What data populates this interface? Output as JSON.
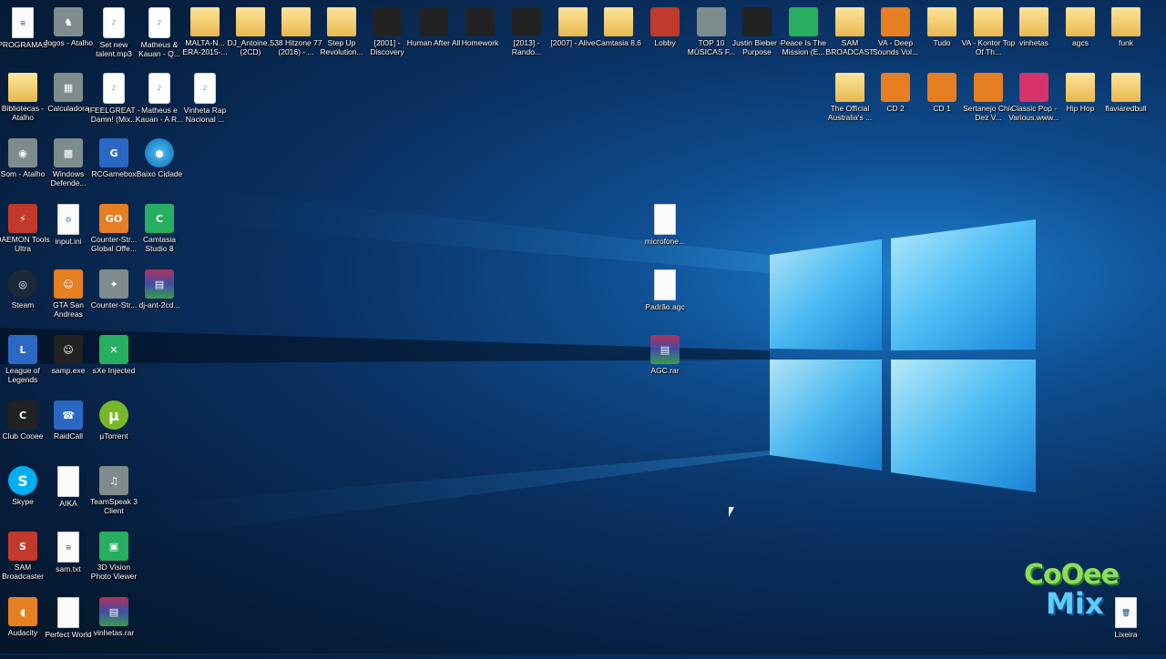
{
  "desktop": {
    "icons": [
      {
        "label": "PROGRAMAS",
        "glyph": "≡",
        "kind": "file",
        "icon": "document-icon"
      },
      {
        "label": "Jogos - Atalho",
        "glyph": "♞",
        "kind": "gray",
        "icon": "chess-icon"
      },
      {
        "label": "Set new talent.mp3",
        "glyph": "♪",
        "kind": "mp3",
        "icon": "mp3-icon"
      },
      {
        "label": "Matheus & Kauan - Q...",
        "glyph": "♪",
        "kind": "mp3",
        "icon": "mp3-icon"
      },
      {
        "label": "MALTA-N... ERA-2015-...",
        "glyph": "",
        "kind": "folder",
        "icon": "folder-icon"
      },
      {
        "label": "DJ_Antoine... (2CD)",
        "glyph": "",
        "kind": "folder",
        "icon": "folder-icon"
      },
      {
        "label": "538 Hitzone 77 (2016) - ...",
        "glyph": "",
        "kind": "folder",
        "icon": "folder-icon"
      },
      {
        "label": "Step Up Revolution...",
        "glyph": "",
        "kind": "folder",
        "icon": "folder-icon"
      },
      {
        "label": "[2001] - Discovery",
        "glyph": "",
        "kind": "dark",
        "icon": "album-folder-icon"
      },
      {
        "label": "Human After All",
        "glyph": "",
        "kind": "dark",
        "icon": "album-folder-icon"
      },
      {
        "label": "Homework",
        "glyph": "",
        "kind": "dark",
        "icon": "album-folder-icon"
      },
      {
        "label": "[2013] - Rando...",
        "glyph": "",
        "kind": "dark",
        "icon": "album-folder-icon"
      },
      {
        "label": "[2007] - Alive",
        "glyph": "",
        "kind": "folder",
        "icon": "folder-icon"
      },
      {
        "label": "Camtasia 8.6",
        "glyph": "",
        "kind": "folder",
        "icon": "folder-icon"
      },
      {
        "label": "Lobby",
        "glyph": "",
        "kind": "red",
        "icon": "album-folder-icon"
      },
      {
        "label": "TOP 10 MÚSICAS F...",
        "glyph": "",
        "kind": "gray",
        "icon": "album-folder-icon"
      },
      {
        "label": "Justin Bieber - Purpose",
        "glyph": "",
        "kind": "dark",
        "icon": "album-folder-icon"
      },
      {
        "label": "Peace Is The Mission (E...",
        "glyph": "",
        "kind": "green",
        "icon": "album-folder-icon"
      },
      {
        "label": "SAM BROADCAST",
        "glyph": "",
        "kind": "folder",
        "icon": "folder-icon"
      },
      {
        "label": "VA - Deep Sounds Vol...",
        "glyph": "",
        "kind": "orange",
        "icon": "album-folder-icon"
      },
      {
        "label": "Tudo",
        "glyph": "",
        "kind": "folder",
        "icon": "folder-icon"
      },
      {
        "label": "VA - Kontor Top Of Th...",
        "glyph": "",
        "kind": "folder",
        "icon": "folder-icon"
      },
      {
        "label": "vinhetas",
        "glyph": "",
        "kind": "folder",
        "icon": "folder-icon"
      },
      {
        "label": "agcs",
        "glyph": "",
        "kind": "folder",
        "icon": "folder-icon"
      },
      {
        "label": "funk",
        "glyph": "",
        "kind": "folder",
        "icon": "folder-icon"
      },
      {
        "label": "Bibliotecas - Atalho",
        "glyph": "",
        "kind": "folder",
        "icon": "libraries-icon"
      },
      {
        "label": "Calculadora",
        "glyph": "▦",
        "kind": "gray",
        "icon": "calculator-icon"
      },
      {
        "label": "IFEELGREAT - Damn! (Mix...",
        "glyph": "♪",
        "kind": "mp3",
        "icon": "mp3-icon"
      },
      {
        "label": "Matheus e Kauan - A R...",
        "glyph": "♪",
        "kind": "mp3",
        "icon": "mp3-icon"
      },
      {
        "label": "Vinheta Rap Nacional ...",
        "glyph": "♪",
        "kind": "mp3",
        "icon": "mp3-icon"
      },
      {
        "label": "The Official Australia's ...",
        "glyph": "",
        "kind": "folder",
        "icon": "folder-icon"
      },
      {
        "label": "CD 2",
        "glyph": "",
        "kind": "orange",
        "icon": "album-folder-icon"
      },
      {
        "label": "CD 1",
        "glyph": "",
        "kind": "orange",
        "icon": "album-folder-icon"
      },
      {
        "label": "Sertanejo Chic Dez V...",
        "glyph": "",
        "kind": "orange",
        "icon": "album-folder-icon"
      },
      {
        "label": "Classic Pop - Various.www...",
        "glyph": "",
        "kind": "pink",
        "icon": "album-folder-icon"
      },
      {
        "label": "Hip Hop",
        "glyph": "",
        "kind": "folder",
        "icon": "folder-icon"
      },
      {
        "label": "flaviaredbull",
        "glyph": "",
        "kind": "folder",
        "icon": "folder-icon"
      },
      {
        "label": "Som - Atalho",
        "glyph": "◉",
        "kind": "gray",
        "icon": "speaker-icon"
      },
      {
        "label": "Windows Defende...",
        "glyph": "▩",
        "kind": "gray",
        "icon": "windows-defender-icon"
      },
      {
        "label": "RCGamebox",
        "glyph": "G",
        "kind": "blue",
        "icon": "rcgamebox-icon"
      },
      {
        "label": "Baixo Cidade",
        "glyph": "●",
        "kind": "globe",
        "icon": "globe-icon"
      },
      {
        "label": "DAEMON Tools Ultra",
        "glyph": "⚡",
        "kind": "red",
        "icon": "daemon-tools-icon"
      },
      {
        "label": "input.ini",
        "glyph": "⚙",
        "kind": "file",
        "icon": "settings-file-icon"
      },
      {
        "label": "Counter-Str... Global Offe...",
        "glyph": "GO",
        "kind": "orange",
        "icon": "csgo-icon"
      },
      {
        "label": "Camtasia Studio 8",
        "glyph": "C",
        "kind": "green",
        "icon": "camtasia-icon"
      },
      {
        "label": "Steam",
        "glyph": "◎",
        "kind": "steam",
        "icon": "steam-icon"
      },
      {
        "label": "GTA San Andreas",
        "glyph": "☺",
        "kind": "orange",
        "icon": "gta-icon"
      },
      {
        "label": "Counter-Str...",
        "glyph": "✦",
        "kind": "gray",
        "icon": "counter-strike-icon"
      },
      {
        "label": "dj-ant-2cd...",
        "glyph": "▤",
        "kind": "rar",
        "icon": "winrar-icon"
      },
      {
        "label": "League of Legends",
        "glyph": "L",
        "kind": "blue",
        "icon": "league-of-legends-icon"
      },
      {
        "label": "samp.exe",
        "glyph": "☺",
        "kind": "dark",
        "icon": "samp-icon"
      },
      {
        "label": "sXe Injected",
        "glyph": "✕",
        "kind": "green",
        "icon": "sxe-icon"
      },
      {
        "label": "Club Cooee",
        "glyph": "C",
        "kind": "dark",
        "icon": "club-cooee-icon"
      },
      {
        "label": "RaidCall",
        "glyph": "☎",
        "kind": "blue",
        "icon": "raidcall-icon"
      },
      {
        "label": "µTorrent",
        "glyph": "µ",
        "kind": "torrent",
        "icon": "utorrent-icon"
      },
      {
        "label": "Skype",
        "glyph": "S",
        "kind": "skype",
        "icon": "skype-icon"
      },
      {
        "label": "AIKA",
        "glyph": "",
        "kind": "file",
        "icon": "document-icon"
      },
      {
        "label": "TeamSpeak 3 Client",
        "glyph": "♫",
        "kind": "gray",
        "icon": "teamspeak-icon"
      },
      {
        "label": "SAM Broadcaster",
        "glyph": "S",
        "kind": "red",
        "icon": "sam-broadcaster-icon"
      },
      {
        "label": "sam.txt",
        "glyph": "≡",
        "kind": "file",
        "icon": "text-file-icon"
      },
      {
        "label": "3D Vision Photo Viewer",
        "glyph": "▣",
        "kind": "green",
        "icon": "3d-vision-icon"
      },
      {
        "label": "Audacity",
        "glyph": "◖",
        "kind": "orange",
        "icon": "audacity-icon"
      },
      {
        "label": "Perfect World",
        "glyph": "",
        "kind": "file",
        "icon": "document-icon"
      },
      {
        "label": "vinhetas.rar",
        "glyph": "▤",
        "kind": "rar",
        "icon": "winrar-icon"
      },
      {
        "label": "microfone...",
        "glyph": "",
        "kind": "file",
        "icon": "document-icon"
      },
      {
        "label": "Padrão.agc",
        "glyph": "",
        "kind": "file",
        "icon": "document-icon"
      },
      {
        "label": "AGC.rar",
        "glyph": "▤",
        "kind": "rar",
        "icon": "winrar-icon"
      },
      {
        "label": "Lixeira",
        "glyph": "🗑",
        "kind": "file",
        "icon": "recycle-bin-icon"
      }
    ]
  },
  "watermark": {
    "line1": "CoOee",
    "line2": "Mix"
  }
}
